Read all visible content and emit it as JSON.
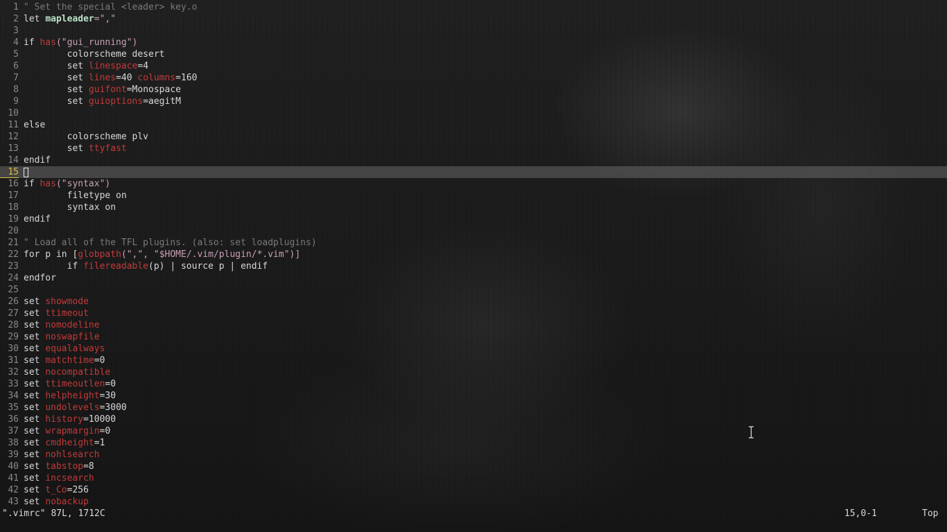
{
  "buffer": {
    "lines": [
      {
        "n": "1",
        "tokens": [
          {
            "t": "\" Set the special <leader> key.o",
            "c": "comment"
          }
        ]
      },
      {
        "n": "2",
        "tokens": [
          {
            "t": "let ",
            "c": "kw"
          },
          {
            "t": "mapleader",
            "c": "var"
          },
          {
            "t": "=\",\"",
            "c": "str"
          }
        ]
      },
      {
        "n": "3",
        "tokens": []
      },
      {
        "n": "4",
        "tokens": [
          {
            "t": "if ",
            "c": "kw"
          },
          {
            "t": "has",
            "c": "func"
          },
          {
            "t": "(\"gui_running\")",
            "c": "str"
          }
        ]
      },
      {
        "n": "5",
        "tokens": [
          {
            "t": "        colorscheme desert",
            "c": "plain"
          }
        ]
      },
      {
        "n": "6",
        "tokens": [
          {
            "t": "        set ",
            "c": "kw"
          },
          {
            "t": "linespace",
            "c": "opt"
          },
          {
            "t": "=4",
            "c": "plain"
          }
        ]
      },
      {
        "n": "7",
        "tokens": [
          {
            "t": "        set ",
            "c": "kw"
          },
          {
            "t": "lines",
            "c": "opt"
          },
          {
            "t": "=40 ",
            "c": "plain"
          },
          {
            "t": "columns",
            "c": "opt"
          },
          {
            "t": "=160",
            "c": "plain"
          }
        ]
      },
      {
        "n": "8",
        "tokens": [
          {
            "t": "        set ",
            "c": "kw"
          },
          {
            "t": "guifont",
            "c": "opt"
          },
          {
            "t": "=Monospace",
            "c": "plain"
          }
        ]
      },
      {
        "n": "9",
        "tokens": [
          {
            "t": "        set ",
            "c": "kw"
          },
          {
            "t": "guioptions",
            "c": "opt"
          },
          {
            "t": "=aegitM",
            "c": "plain"
          }
        ]
      },
      {
        "n": "10",
        "tokens": []
      },
      {
        "n": "11",
        "tokens": [
          {
            "t": "else",
            "c": "kw"
          }
        ]
      },
      {
        "n": "12",
        "tokens": [
          {
            "t": "        colorscheme plv",
            "c": "plain"
          }
        ]
      },
      {
        "n": "13",
        "tokens": [
          {
            "t": "        set ",
            "c": "kw"
          },
          {
            "t": "ttyfast",
            "c": "opt"
          }
        ]
      },
      {
        "n": "14",
        "tokens": [
          {
            "t": "endif",
            "c": "kw"
          }
        ]
      },
      {
        "n": "15",
        "tokens": [],
        "current": true
      },
      {
        "n": "16",
        "tokens": [
          {
            "t": "if ",
            "c": "kw"
          },
          {
            "t": "has",
            "c": "func"
          },
          {
            "t": "(\"syntax\")",
            "c": "str"
          }
        ]
      },
      {
        "n": "17",
        "tokens": [
          {
            "t": "        filetype on",
            "c": "plain"
          }
        ]
      },
      {
        "n": "18",
        "tokens": [
          {
            "t": "        syntax on",
            "c": "plain"
          }
        ]
      },
      {
        "n": "19",
        "tokens": [
          {
            "t": "endif",
            "c": "kw"
          }
        ]
      },
      {
        "n": "20",
        "tokens": []
      },
      {
        "n": "21",
        "tokens": [
          {
            "t": "\" Load all of the TFL plugins. (also: set loadplugins)",
            "c": "comment"
          }
        ]
      },
      {
        "n": "22",
        "tokens": [
          {
            "t": "for p in [",
            "c": "kw"
          },
          {
            "t": "globpath",
            "c": "func"
          },
          {
            "t": "(\",\", \"$HOME/.vim/plugin/*.vim\")]",
            "c": "str"
          }
        ]
      },
      {
        "n": "23",
        "tokens": [
          {
            "t": "        if ",
            "c": "kw"
          },
          {
            "t": "filereadable",
            "c": "func"
          },
          {
            "t": "(p) | source p | endif",
            "c": "plain"
          }
        ]
      },
      {
        "n": "24",
        "tokens": [
          {
            "t": "endfor",
            "c": "kw"
          }
        ]
      },
      {
        "n": "25",
        "tokens": []
      },
      {
        "n": "26",
        "tokens": [
          {
            "t": "set ",
            "c": "kw"
          },
          {
            "t": "showmode",
            "c": "opt"
          }
        ]
      },
      {
        "n": "27",
        "tokens": [
          {
            "t": "set ",
            "c": "kw"
          },
          {
            "t": "ttimeout",
            "c": "opt"
          }
        ]
      },
      {
        "n": "28",
        "tokens": [
          {
            "t": "set ",
            "c": "kw"
          },
          {
            "t": "nomodeline",
            "c": "opt"
          }
        ]
      },
      {
        "n": "29",
        "tokens": [
          {
            "t": "set ",
            "c": "kw"
          },
          {
            "t": "noswapfile",
            "c": "opt"
          }
        ]
      },
      {
        "n": "30",
        "tokens": [
          {
            "t": "set ",
            "c": "kw"
          },
          {
            "t": "equalalways",
            "c": "opt"
          }
        ]
      },
      {
        "n": "31",
        "tokens": [
          {
            "t": "set ",
            "c": "kw"
          },
          {
            "t": "matchtime",
            "c": "opt"
          },
          {
            "t": "=0",
            "c": "plain"
          }
        ]
      },
      {
        "n": "32",
        "tokens": [
          {
            "t": "set ",
            "c": "kw"
          },
          {
            "t": "nocompatible",
            "c": "opt"
          }
        ]
      },
      {
        "n": "33",
        "tokens": [
          {
            "t": "set ",
            "c": "kw"
          },
          {
            "t": "ttimeoutlen",
            "c": "opt"
          },
          {
            "t": "=0",
            "c": "plain"
          }
        ]
      },
      {
        "n": "34",
        "tokens": [
          {
            "t": "set ",
            "c": "kw"
          },
          {
            "t": "helpheight",
            "c": "opt"
          },
          {
            "t": "=30",
            "c": "plain"
          }
        ]
      },
      {
        "n": "35",
        "tokens": [
          {
            "t": "set ",
            "c": "kw"
          },
          {
            "t": "undolevels",
            "c": "opt"
          },
          {
            "t": "=3000",
            "c": "plain"
          }
        ]
      },
      {
        "n": "36",
        "tokens": [
          {
            "t": "set ",
            "c": "kw"
          },
          {
            "t": "history",
            "c": "opt"
          },
          {
            "t": "=10000",
            "c": "plain"
          }
        ]
      },
      {
        "n": "37",
        "tokens": [
          {
            "t": "set ",
            "c": "kw"
          },
          {
            "t": "wrapmargin",
            "c": "opt"
          },
          {
            "t": "=0",
            "c": "plain"
          }
        ]
      },
      {
        "n": "38",
        "tokens": [
          {
            "t": "set ",
            "c": "kw"
          },
          {
            "t": "cmdheight",
            "c": "opt"
          },
          {
            "t": "=1",
            "c": "plain"
          }
        ]
      },
      {
        "n": "39",
        "tokens": [
          {
            "t": "set ",
            "c": "kw"
          },
          {
            "t": "nohlsearch",
            "c": "opt"
          }
        ]
      },
      {
        "n": "40",
        "tokens": [
          {
            "t": "set ",
            "c": "kw"
          },
          {
            "t": "tabstop",
            "c": "opt"
          },
          {
            "t": "=8",
            "c": "plain"
          }
        ]
      },
      {
        "n": "41",
        "tokens": [
          {
            "t": "set ",
            "c": "kw"
          },
          {
            "t": "incsearch",
            "c": "opt"
          }
        ]
      },
      {
        "n": "42",
        "tokens": [
          {
            "t": "set ",
            "c": "kw"
          },
          {
            "t": "t_Co",
            "c": "opt"
          },
          {
            "t": "=256",
            "c": "plain"
          }
        ]
      },
      {
        "n": "43",
        "tokens": [
          {
            "t": "set ",
            "c": "kw"
          },
          {
            "t": "nobackup",
            "c": "opt"
          }
        ]
      }
    ]
  },
  "statusline": {
    "file_info": "\".vimrc\" 87L, 1712C",
    "cursor_pos": "15,0-1",
    "scroll": "Top"
  },
  "mouse": {
    "pointer_icon": "text-ibeam-icon"
  },
  "colors": {
    "comment": "#7a7a7a",
    "option": "#c23a3a",
    "string": "#c9a0b8",
    "variable": "#b8e2c8",
    "current_line_number": "#e0c040",
    "text": "#d8d8d8"
  }
}
